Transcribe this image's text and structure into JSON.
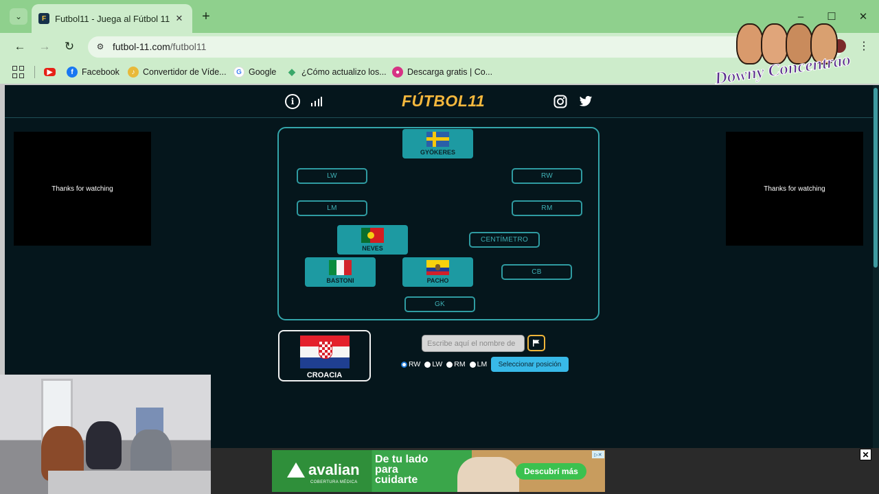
{
  "browser": {
    "tab": {
      "title": "Futbol11 - Juega al Fútbol 11",
      "close": "✕"
    },
    "new_tab": "+",
    "window": {
      "minimize": "–",
      "maximize": "☐",
      "close": "✕"
    },
    "nav": {
      "back": "←",
      "forward": "→",
      "reload": "↻"
    },
    "url": {
      "host": "futbol-11.com",
      "path": "/futbol11"
    },
    "menu": "⋮",
    "bookmarks": [
      {
        "label": "",
        "icon": "youtube-icon",
        "color": "#e62117"
      },
      {
        "label": "Facebook",
        "icon": "facebook-icon",
        "color": "#1877f2"
      },
      {
        "label": "Convertidor de Víde...",
        "icon": "converter-icon",
        "color": "#e8b93a"
      },
      {
        "label": "Google",
        "icon": "google-icon",
        "color": "#4285f4"
      },
      {
        "label": "¿Cómo actualizo los...",
        "icon": "diamond-icon",
        "color": "#3aa86a"
      },
      {
        "label": "Descarga gratis | Co...",
        "icon": "drop-icon",
        "color": "#d63384"
      }
    ]
  },
  "site": {
    "logo": "FÚTBOL11",
    "side_ads": {
      "left": "Thanks for watching",
      "right": "Thanks for watching"
    }
  },
  "pitch": {
    "empty_positions": {
      "lw": "LW",
      "rw": "RW",
      "lm": "LM",
      "rm": "RM",
      "centimetro": "CENTÍMETRO",
      "cb": "CB",
      "gk": "GK"
    },
    "players": {
      "striker": {
        "name": "GYÖKERES",
        "flag": "sweden"
      },
      "midfield": {
        "name": "NEVES",
        "flag": "portugal"
      },
      "defender_left": {
        "name": "BASTONI",
        "flag": "italy"
      },
      "defender_center": {
        "name": "PACHO",
        "flag": "ecuador"
      }
    }
  },
  "challenge": {
    "country": "CROACIA",
    "input_placeholder": "Escribe aquí el nombre de",
    "positions": [
      {
        "label": "RW",
        "checked": true
      },
      {
        "label": "LW",
        "checked": false
      },
      {
        "label": "RM",
        "checked": false
      },
      {
        "label": "LM",
        "checked": false
      }
    ],
    "select_button": "Seleccionar posición"
  },
  "overlay_ad": {
    "brand": "avalian",
    "brand_sub": "COBERTURA MÉDICA",
    "headline": "De tu lado para cuidarte",
    "cta": "Descubrí más",
    "close": "✕"
  },
  "streamer": {
    "name": "Downy Concentrao"
  }
}
